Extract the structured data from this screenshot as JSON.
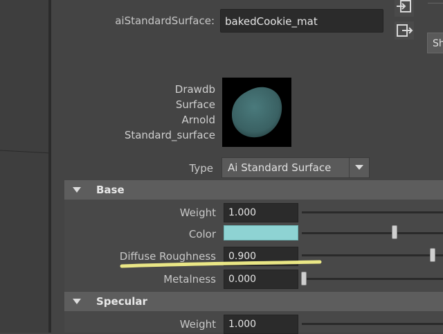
{
  "material": {
    "label": "aiStandardSurface:",
    "name": "bakedCookie_mat"
  },
  "header_buttons": {
    "sh_label": "Sh"
  },
  "node_type": {
    "lines": [
      "Drawdb",
      "Surface",
      "Arnold",
      "Standard_surface"
    ],
    "type_label": "Type",
    "type_value": "Ai Standard Surface",
    "swatch_color": "#3d6466"
  },
  "sections": {
    "base": {
      "title": "Base",
      "weight": {
        "label": "Weight",
        "value": "1.000",
        "fraction": 1.0
      },
      "color": {
        "label": "Color",
        "hex": "#8ed3d3",
        "slider_fraction": 0.6
      },
      "diffuse_roughness": {
        "label": "Diffuse Roughness",
        "value": "0.900",
        "fraction": 0.9
      },
      "metalness": {
        "label": "Metalness",
        "value": "0.000",
        "fraction": 0.0
      }
    },
    "specular": {
      "title": "Specular",
      "weight": {
        "label": "Weight",
        "value": "1.000"
      }
    }
  },
  "annotation": {
    "highlight_color": "#f3f08a"
  }
}
